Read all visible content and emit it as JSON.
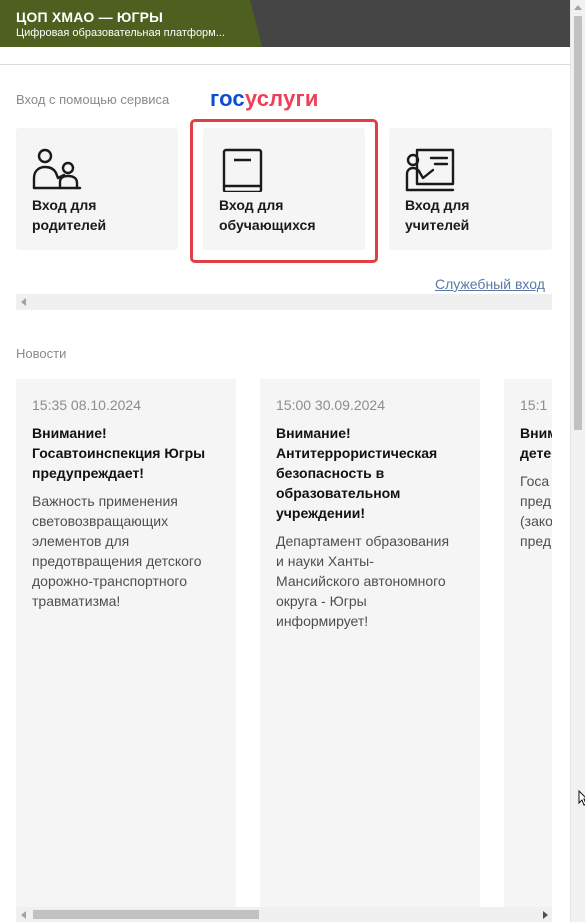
{
  "header": {
    "title": "ЦОП ХМАО — ЮГРЫ",
    "subtitle": "Цифровая образовательная платформ..."
  },
  "login": {
    "label": "Вход с помощью сервиса",
    "logo_part1": "гос",
    "logo_part2": "услуги",
    "logo_colors": {
      "part1": "#0d4cd3",
      "part2": "#ee3f58"
    }
  },
  "login_cards": [
    {
      "label": "Вход для родителей",
      "icon": "parents-icon"
    },
    {
      "label": "Вход для обучающихся",
      "icon": "book-icon",
      "highlighted": true
    },
    {
      "label": "Вход для учителей",
      "icon": "teacher-board-icon"
    }
  ],
  "service_link": "Служебный вход",
  "news": {
    "heading": "Новости",
    "items": [
      {
        "date": "15:35 08.10.2024",
        "title": "Внимание!\nГосавтоинспекция Югры\nпредупреждает!",
        "text": "Важность применения\nсветовозвращающих\nэлементов для\nпредотвращения детского\nдорожно-транспортного\nтравматизма!"
      },
      {
        "date": "15:00 30.09.2024",
        "title": "Внимание!\nАнтитеррористическая\nбезопасность в\nобразовательном\nучреждении!",
        "text": "Департамент образования\nи науки Ханты-\nМансийского автономного\nокруга - Югры\nинформирует!"
      },
      {
        "date": "15:1",
        "title": "Вним\nдете",
        "text": "Госа\nпред\n(зако\nпред"
      }
    ]
  },
  "colors": {
    "header_green": "#4e5f20",
    "header_gray": "#454545",
    "highlight": "#e13f48",
    "link": "#5b79a4"
  }
}
